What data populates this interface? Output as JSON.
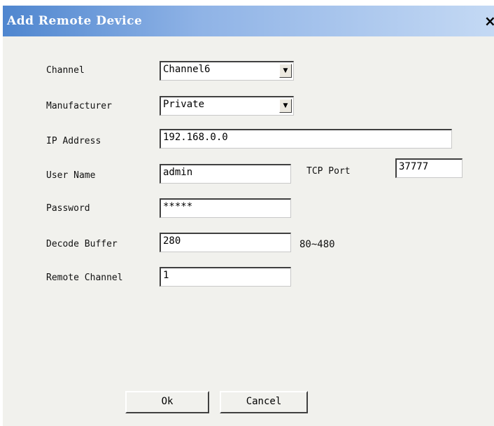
{
  "dialog": {
    "title": "Add Remote Device",
    "close_glyph": "×"
  },
  "form": {
    "channel": {
      "label": "Channel",
      "value": "Channel6"
    },
    "manufacturer": {
      "label": "Manufacturer",
      "value": "Private"
    },
    "ip_address": {
      "label": "IP Address",
      "value": "192.168.0.0"
    },
    "user_name": {
      "label": "User Name",
      "value": "admin"
    },
    "tcp_port": {
      "label": "TCP Port",
      "value": "37777"
    },
    "password": {
      "label": "Password",
      "value": "*****"
    },
    "decode_buffer": {
      "label": "Decode Buffer",
      "value": "280",
      "range_hint": "80~480"
    },
    "remote_channel": {
      "label": "Remote Channel",
      "value": "1"
    },
    "dropdown_arrow_glyph": "▼"
  },
  "buttons": {
    "ok": "Ok",
    "cancel": "Cancel"
  }
}
